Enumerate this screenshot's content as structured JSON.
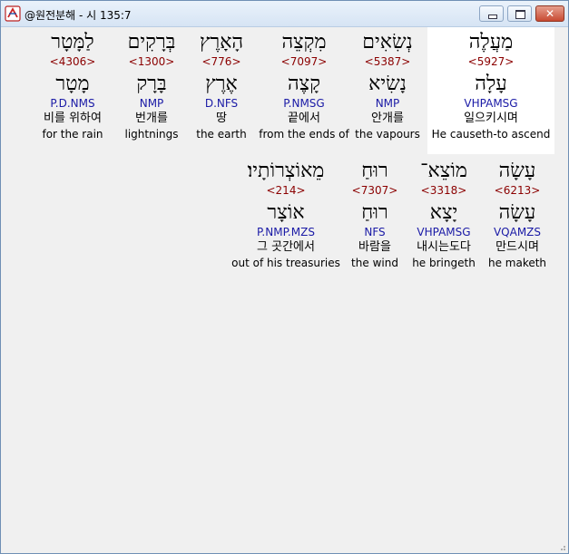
{
  "window": {
    "title": "@원전분해 - 시 135:7",
    "icon": "app-logo-icon",
    "close_label": "✕"
  },
  "rows": [
    {
      "words": [
        {
          "hebrew": "מַעֲלֶה",
          "strong": "<5927>",
          "lemma": "עָלָה",
          "morph": "VHPAMSG",
          "korean": "일으키시며",
          "english": "He causeth-to ascend",
          "highlight": true
        },
        {
          "hebrew": "נְשִׂאִים",
          "strong": "<5387>",
          "lemma": "נָשִׂיא",
          "morph": "NMP",
          "korean": "안개를",
          "english": "the vapours"
        },
        {
          "hebrew": "מִקְצֵה",
          "strong": "<7097>",
          "lemma": "קָצֶה",
          "morph": "P.NMSG",
          "korean": "끝에서",
          "english": "from the ends of"
        },
        {
          "hebrew": "הָאָרֶץ",
          "strong": "<776>",
          "lemma": "אֶרֶץ",
          "morph": "D.NFS",
          "korean": "땅",
          "english": "the earth"
        },
        {
          "hebrew": "בְּרָקִים",
          "strong": "<1300>",
          "lemma": "בָּרָק",
          "morph": "NMP",
          "korean": "번개를",
          "english": "lightnings"
        },
        {
          "hebrew": "לַמָּטָר",
          "strong": "<4306>",
          "lemma": "מָטָר",
          "morph": "P.D.NMS",
          "korean": "비를 위하여",
          "english": "for the rain"
        }
      ]
    },
    {
      "words": [
        {
          "hebrew": "עָשָׂה",
          "strong": "<6213>",
          "lemma": "עָשָׂה",
          "morph": "VQAMZS",
          "korean": "만드시며",
          "english": "he maketh"
        },
        {
          "hebrew": "מוֹצֵא־",
          "strong": "<3318>",
          "lemma": "יָצָא",
          "morph": "VHPAMSG",
          "korean": "내시는도다",
          "english": "he bringeth"
        },
        {
          "hebrew": "רוּחַ",
          "strong": "<7307>",
          "lemma": "רוּחַ",
          "morph": "NFS",
          "korean": "바람을",
          "english": "the wind"
        },
        {
          "hebrew": "מֵאוֹצְרוֹתָיו׃",
          "strong": "<214>",
          "lemma": "אוֹצָר",
          "morph": "P.NMP.MZS",
          "korean": "그 곳간에서",
          "english": "out of his treasuries"
        }
      ]
    }
  ]
}
